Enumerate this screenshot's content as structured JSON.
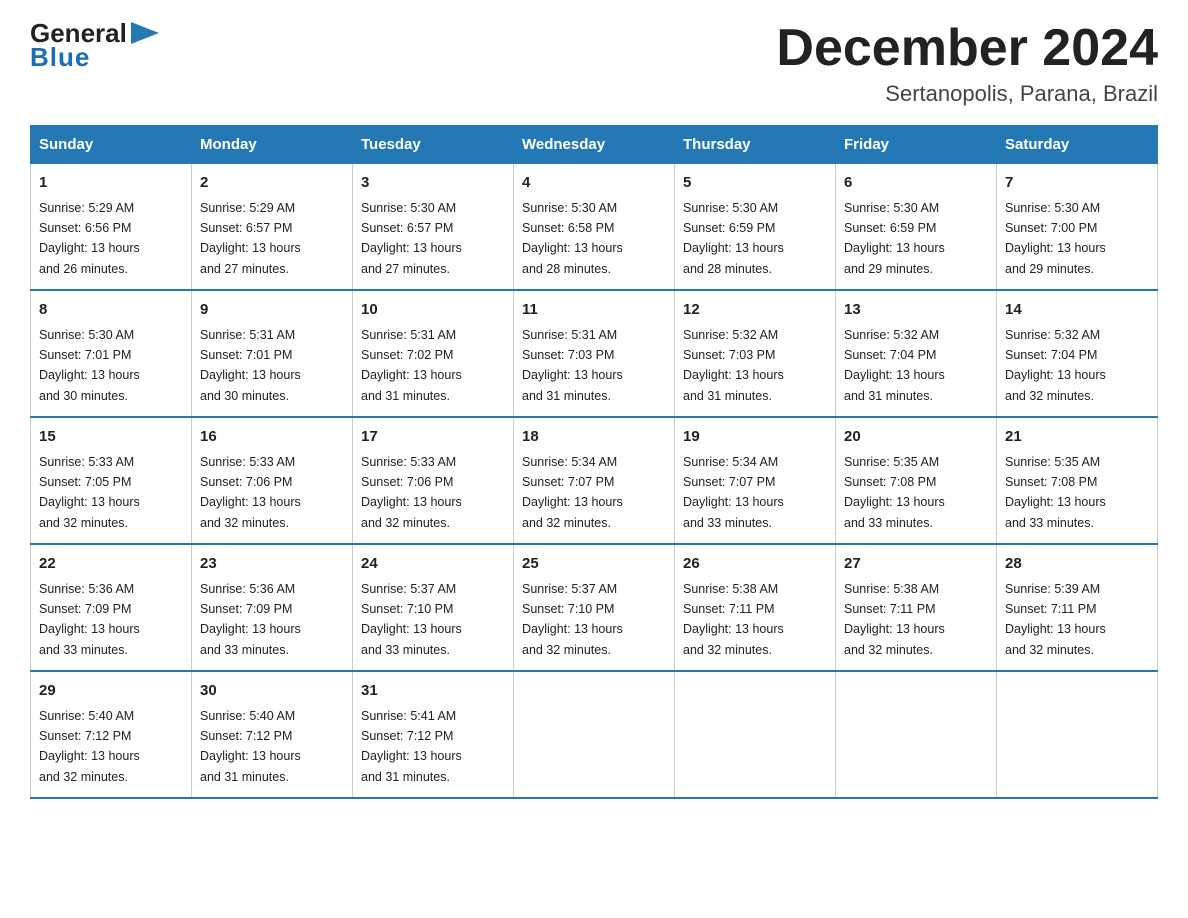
{
  "logo": {
    "general": "General",
    "blue": "Blue",
    "arrow": "▶"
  },
  "header": {
    "month_year": "December 2024",
    "location": "Sertanopolis, Parana, Brazil"
  },
  "days_of_week": [
    "Sunday",
    "Monday",
    "Tuesday",
    "Wednesday",
    "Thursday",
    "Friday",
    "Saturday"
  ],
  "weeks": [
    [
      {
        "day": "1",
        "sunrise": "5:29 AM",
        "sunset": "6:56 PM",
        "daylight": "13 hours and 26 minutes."
      },
      {
        "day": "2",
        "sunrise": "5:29 AM",
        "sunset": "6:57 PM",
        "daylight": "13 hours and 27 minutes."
      },
      {
        "day": "3",
        "sunrise": "5:30 AM",
        "sunset": "6:57 PM",
        "daylight": "13 hours and 27 minutes."
      },
      {
        "day": "4",
        "sunrise": "5:30 AM",
        "sunset": "6:58 PM",
        "daylight": "13 hours and 28 minutes."
      },
      {
        "day": "5",
        "sunrise": "5:30 AM",
        "sunset": "6:59 PM",
        "daylight": "13 hours and 28 minutes."
      },
      {
        "day": "6",
        "sunrise": "5:30 AM",
        "sunset": "6:59 PM",
        "daylight": "13 hours and 29 minutes."
      },
      {
        "day": "7",
        "sunrise": "5:30 AM",
        "sunset": "7:00 PM",
        "daylight": "13 hours and 29 minutes."
      }
    ],
    [
      {
        "day": "8",
        "sunrise": "5:30 AM",
        "sunset": "7:01 PM",
        "daylight": "13 hours and 30 minutes."
      },
      {
        "day": "9",
        "sunrise": "5:31 AM",
        "sunset": "7:01 PM",
        "daylight": "13 hours and 30 minutes."
      },
      {
        "day": "10",
        "sunrise": "5:31 AM",
        "sunset": "7:02 PM",
        "daylight": "13 hours and 31 minutes."
      },
      {
        "day": "11",
        "sunrise": "5:31 AM",
        "sunset": "7:03 PM",
        "daylight": "13 hours and 31 minutes."
      },
      {
        "day": "12",
        "sunrise": "5:32 AM",
        "sunset": "7:03 PM",
        "daylight": "13 hours and 31 minutes."
      },
      {
        "day": "13",
        "sunrise": "5:32 AM",
        "sunset": "7:04 PM",
        "daylight": "13 hours and 31 minutes."
      },
      {
        "day": "14",
        "sunrise": "5:32 AM",
        "sunset": "7:04 PM",
        "daylight": "13 hours and 32 minutes."
      }
    ],
    [
      {
        "day": "15",
        "sunrise": "5:33 AM",
        "sunset": "7:05 PM",
        "daylight": "13 hours and 32 minutes."
      },
      {
        "day": "16",
        "sunrise": "5:33 AM",
        "sunset": "7:06 PM",
        "daylight": "13 hours and 32 minutes."
      },
      {
        "day": "17",
        "sunrise": "5:33 AM",
        "sunset": "7:06 PM",
        "daylight": "13 hours and 32 minutes."
      },
      {
        "day": "18",
        "sunrise": "5:34 AM",
        "sunset": "7:07 PM",
        "daylight": "13 hours and 32 minutes."
      },
      {
        "day": "19",
        "sunrise": "5:34 AM",
        "sunset": "7:07 PM",
        "daylight": "13 hours and 33 minutes."
      },
      {
        "day": "20",
        "sunrise": "5:35 AM",
        "sunset": "7:08 PM",
        "daylight": "13 hours and 33 minutes."
      },
      {
        "day": "21",
        "sunrise": "5:35 AM",
        "sunset": "7:08 PM",
        "daylight": "13 hours and 33 minutes."
      }
    ],
    [
      {
        "day": "22",
        "sunrise": "5:36 AM",
        "sunset": "7:09 PM",
        "daylight": "13 hours and 33 minutes."
      },
      {
        "day": "23",
        "sunrise": "5:36 AM",
        "sunset": "7:09 PM",
        "daylight": "13 hours and 33 minutes."
      },
      {
        "day": "24",
        "sunrise": "5:37 AM",
        "sunset": "7:10 PM",
        "daylight": "13 hours and 33 minutes."
      },
      {
        "day": "25",
        "sunrise": "5:37 AM",
        "sunset": "7:10 PM",
        "daylight": "13 hours and 32 minutes."
      },
      {
        "day": "26",
        "sunrise": "5:38 AM",
        "sunset": "7:11 PM",
        "daylight": "13 hours and 32 minutes."
      },
      {
        "day": "27",
        "sunrise": "5:38 AM",
        "sunset": "7:11 PM",
        "daylight": "13 hours and 32 minutes."
      },
      {
        "day": "28",
        "sunrise": "5:39 AM",
        "sunset": "7:11 PM",
        "daylight": "13 hours and 32 minutes."
      }
    ],
    [
      {
        "day": "29",
        "sunrise": "5:40 AM",
        "sunset": "7:12 PM",
        "daylight": "13 hours and 32 minutes."
      },
      {
        "day": "30",
        "sunrise": "5:40 AM",
        "sunset": "7:12 PM",
        "daylight": "13 hours and 31 minutes."
      },
      {
        "day": "31",
        "sunrise": "5:41 AM",
        "sunset": "7:12 PM",
        "daylight": "13 hours and 31 minutes."
      },
      null,
      null,
      null,
      null
    ]
  ],
  "labels": {
    "sunrise": "Sunrise:",
    "sunset": "Sunset:",
    "daylight": "Daylight:"
  }
}
